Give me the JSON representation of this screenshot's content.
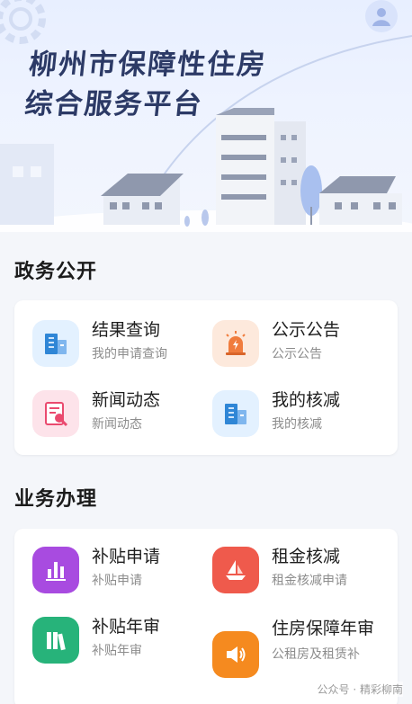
{
  "banner": {
    "title_line1": "柳州市保障性住房",
    "title_line2": "综合服务平台"
  },
  "sections": [
    {
      "title": "政务公开",
      "items": [
        {
          "title": "结果查询",
          "subtitle": "我的申请查询",
          "icon": "building-icon",
          "color": "#2f86d6"
        },
        {
          "title": "公示公告",
          "subtitle": "公示公告",
          "icon": "alarm-icon",
          "color": "#f07c3d"
        },
        {
          "title": "新闻动态",
          "subtitle": "新闻动态",
          "icon": "document-search-icon",
          "color": "#ea4a6f"
        },
        {
          "title": "我的核减",
          "subtitle": "我的核减",
          "icon": "building-icon",
          "color": "#2f86d6"
        }
      ]
    },
    {
      "title": "业务办理",
      "items": [
        {
          "title": "补贴申请",
          "subtitle": "补贴申请",
          "icon": "bar-chart-icon",
          "color": "#a84be0"
        },
        {
          "title": "租金核减",
          "subtitle": "租金核减申请",
          "icon": "boat-icon",
          "color": "#ef5a4c"
        },
        {
          "title": "补贴年审",
          "subtitle": "补贴年审",
          "icon": "books-icon",
          "color": "#27b37a"
        },
        {
          "title": "住房保障年审",
          "subtitle": "公租房及租赁补",
          "icon": "speaker-icon",
          "color": "#f58a1f"
        }
      ]
    }
  ],
  "watermark": "公众号 · 精彩柳南"
}
